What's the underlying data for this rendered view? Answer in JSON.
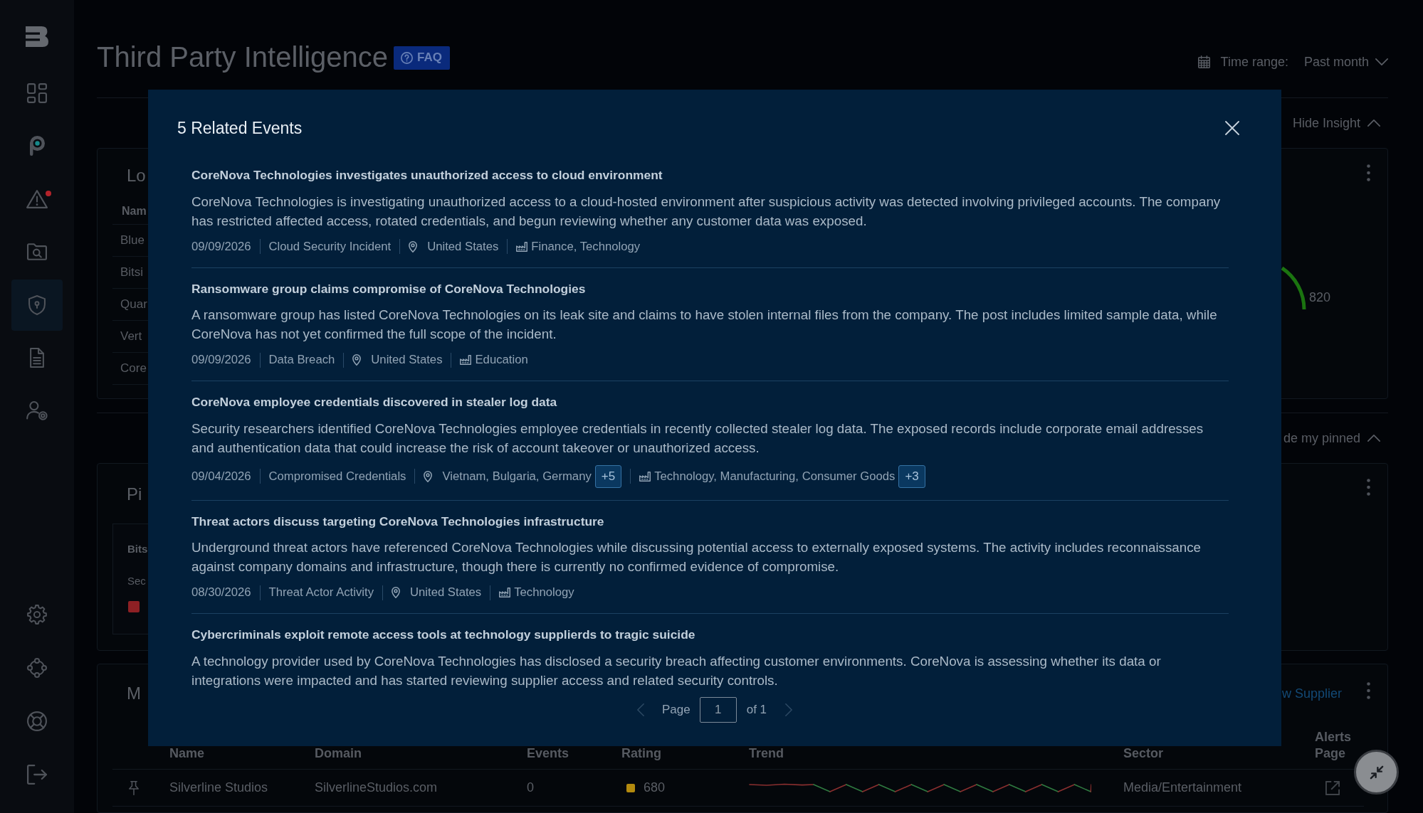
{
  "sidebar": {
    "top_items": [
      {
        "selected": false,
        "notification": false
      },
      {
        "selected": false,
        "notification": false
      },
      {
        "selected": false,
        "notification": true
      },
      {
        "selected": false,
        "notification": false
      },
      {
        "selected": true,
        "notification": false
      },
      {
        "selected": false,
        "notification": false
      },
      {
        "selected": false,
        "notification": false
      }
    ],
    "bottom_items": [
      {
        "selected": false,
        "notification": false
      },
      {
        "selected": false,
        "notification": false
      },
      {
        "selected": false,
        "notification": false
      },
      {
        "selected": false,
        "notification": false
      }
    ]
  },
  "header": {
    "title": "Third Party Intelligence",
    "faq_label": "FAQ",
    "time_range": {
      "label": "Time range:",
      "value": "Past month"
    }
  },
  "insight_toggle": {
    "label": "Hide Insight",
    "expanded": true
  },
  "insight_card": {
    "title": "Lo",
    "column_1": "Nam",
    "rows": [
      "Blue",
      "Bitsi",
      "Quar",
      "Vert",
      "Core"
    ],
    "gauge_value": "820"
  },
  "pinned_toggle": {
    "label": "de my pinned",
    "expanded": true
  },
  "pinned_card": {
    "title": "Pi",
    "item": {
      "name": "Bits",
      "label": "Sec"
    }
  },
  "suppliers_card": {
    "title": "M",
    "link": "w Supplier",
    "columns": [
      "Name",
      "Domain",
      "Events",
      "Rating",
      "Trend",
      "Sector",
      "Alerts Page"
    ],
    "rows": [
      {
        "name": "Silverline Studios",
        "domain": "SilverlineStudios.com",
        "events": "0",
        "rating": "680",
        "color": "#b38a0e",
        "sector": "Media/Entertainment"
      }
    ]
  },
  "modal": {
    "title": "5 Related Events",
    "events": [
      {
        "title": "CoreNova Technologies investigates unauthorized access to cloud environment",
        "description": "CoreNova Technologies is investigating unauthorized access to a cloud-hosted environment after suspicious activity was detected involving privileged accounts. The company has restricted affected access, rotated credentials, and begun reviewing whether any customer data was exposed.",
        "date": "09/09/2026",
        "type": "Cloud Security Incident",
        "locations": "United States",
        "sectors": "Finance, Technology"
      },
      {
        "title": "Ransomware group claims compromise of CoreNova Technologies",
        "description": "A ransomware group has listed CoreNova Technologies on its leak site and claims to have stolen internal files from the company. The post includes limited sample data, while CoreNova has not yet confirmed the full scope of the incident.",
        "date": "09/09/2026",
        "type": "Data Breach",
        "locations": "United States",
        "sectors": "Education"
      },
      {
        "title": "CoreNova employee credentials discovered in stealer log data",
        "description": "Security researchers identified CoreNova Technologies employee credentials in recently collected stealer log data. The exposed records include corporate email addresses and authentication data that could increase the risk of account takeover or unauthorized access.",
        "date": "09/04/2026",
        "type": "Compromised Credentials",
        "locations": "Vietnam, Bulgaria, Germany",
        "more_locations": "+5",
        "sectors": "Technology, Manufacturing, Consumer Goods",
        "more_sectors": "+3"
      },
      {
        "title": "Threat actors discuss targeting CoreNova Technologies infrastructure",
        "description": "Underground threat actors have referenced CoreNova Technologies while discussing potential access to externally exposed systems. The activity includes reconnaissance against company domains and infrastructure, though there is currently no confirmed evidence of compromise.",
        "date": "08/30/2026",
        "type": "Threat Actor Activity",
        "locations": "United States",
        "sectors": "Technology"
      },
      {
        "title": "Cybercriminals exploit remote access tools at technology supplierds to tragic suicide",
        "description": "A technology provider used by CoreNova Technologies has disclosed a security breach affecting customer environments. CoreNova is assessing whether its data or integrations were impacted and has started reviewing supplier access and related security controls."
      }
    ],
    "pagination": {
      "page_label": "Page",
      "page": "1",
      "total_label": "of 1",
      "prev_disabled": true,
      "next_disabled": true
    }
  }
}
